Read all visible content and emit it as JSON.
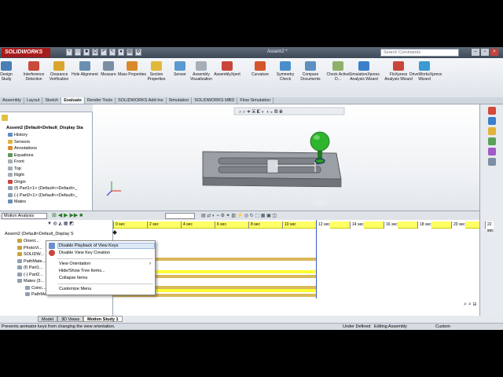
{
  "app": {
    "logo": "SOLIDWORKS",
    "doc_title": "Assem2 *",
    "search_placeholder": "Search Commands"
  },
  "ribbon": {
    "buttons": [
      {
        "label": "Design Study",
        "color": "#4a7fb5"
      },
      {
        "label": "Interference Detection",
        "color": "#c94b3a"
      },
      {
        "label": "Clearance Verification",
        "color": "#d9a52a"
      },
      {
        "label": "Hole Alignment",
        "color": "#6a8fb0"
      },
      {
        "label": "Measure",
        "color": "#7b8ea3"
      },
      {
        "label": "Mass Properties",
        "color": "#d98a2a"
      },
      {
        "label": "Section Properties",
        "color": "#e1b93a"
      },
      {
        "label": "Sensor",
        "color": "#5a9ad1"
      },
      {
        "label": "Assembly Visualization",
        "color": "#a6aeb8"
      },
      {
        "label": "AssemblyXpert",
        "color": "#c9473a"
      },
      {
        "label": "Curvature",
        "color": "#d4572a"
      },
      {
        "label": "Symmetry Check",
        "color": "#4a8fc9"
      },
      {
        "label": "Compare Documents",
        "color": "#5e8fc0"
      },
      {
        "label": "Check Active D...",
        "color": "#8fb06a"
      },
      {
        "label": "SimulationXpress Analysis Wizard",
        "color": "#3a7fc9"
      },
      {
        "label": "FloXpress Analysis Wizard",
        "color": "#c9473a"
      },
      {
        "label": "DriveWorksXpress Wizard",
        "color": "#3a9ad1"
      }
    ]
  },
  "command_tabs": [
    "Assembly",
    "Layout",
    "Sketch",
    "Evaluate",
    "Render Tools",
    "SOLIDWORKS Add-Ins",
    "Simulation",
    "SOLIDWORKS MBD",
    "Flow Simulation"
  ],
  "active_command_tab": "Evaluate",
  "feature_tree": {
    "root": "Assem2  (Default<Default_Display Sta",
    "items": [
      "History",
      "Sensors",
      "Annotations",
      "Equations",
      "Front",
      "Top",
      "Right",
      "Origin",
      "(f) Part1<1> (Default<<Default>_",
      "(-) Part2<1> (Default<<Default>_",
      "Mates"
    ]
  },
  "motion": {
    "study_type": "Motion Analysis",
    "tree_root": "Assem2  (Default<Default_Display S",
    "tree_items": [
      "Orient...",
      "PhotoVi...",
      "SOLIDW...",
      "PathMate...",
      "(f) Part1...",
      "(-) Part2...",
      "Mates (3...",
      "Coinc...",
      "PathMate..."
    ],
    "ticks": [
      "0 sec",
      "2 sec",
      "4 sec",
      "6 sec",
      "8 sec",
      "10 sec",
      "12 sec",
      "14 sec",
      "16 sec",
      "18 sec",
      "20 sec",
      "22 sec"
    ]
  },
  "context_menu": {
    "items": [
      "Disable Playback of View Keys",
      "Disable View Key Creation",
      "View Orientation",
      "Hide/Show Tree Items...",
      "Collapse Items",
      "Customize Menu"
    ]
  },
  "bottom_tabs": [
    "Model",
    "3D Views",
    "Motion Study 1"
  ],
  "active_bottom_tab": "Motion Study 1",
  "status": {
    "hint": "Prevents animator keys from changing the view orientation.",
    "state": "Under Defined",
    "mode": "Editing Assembly",
    "units": "Custom"
  }
}
